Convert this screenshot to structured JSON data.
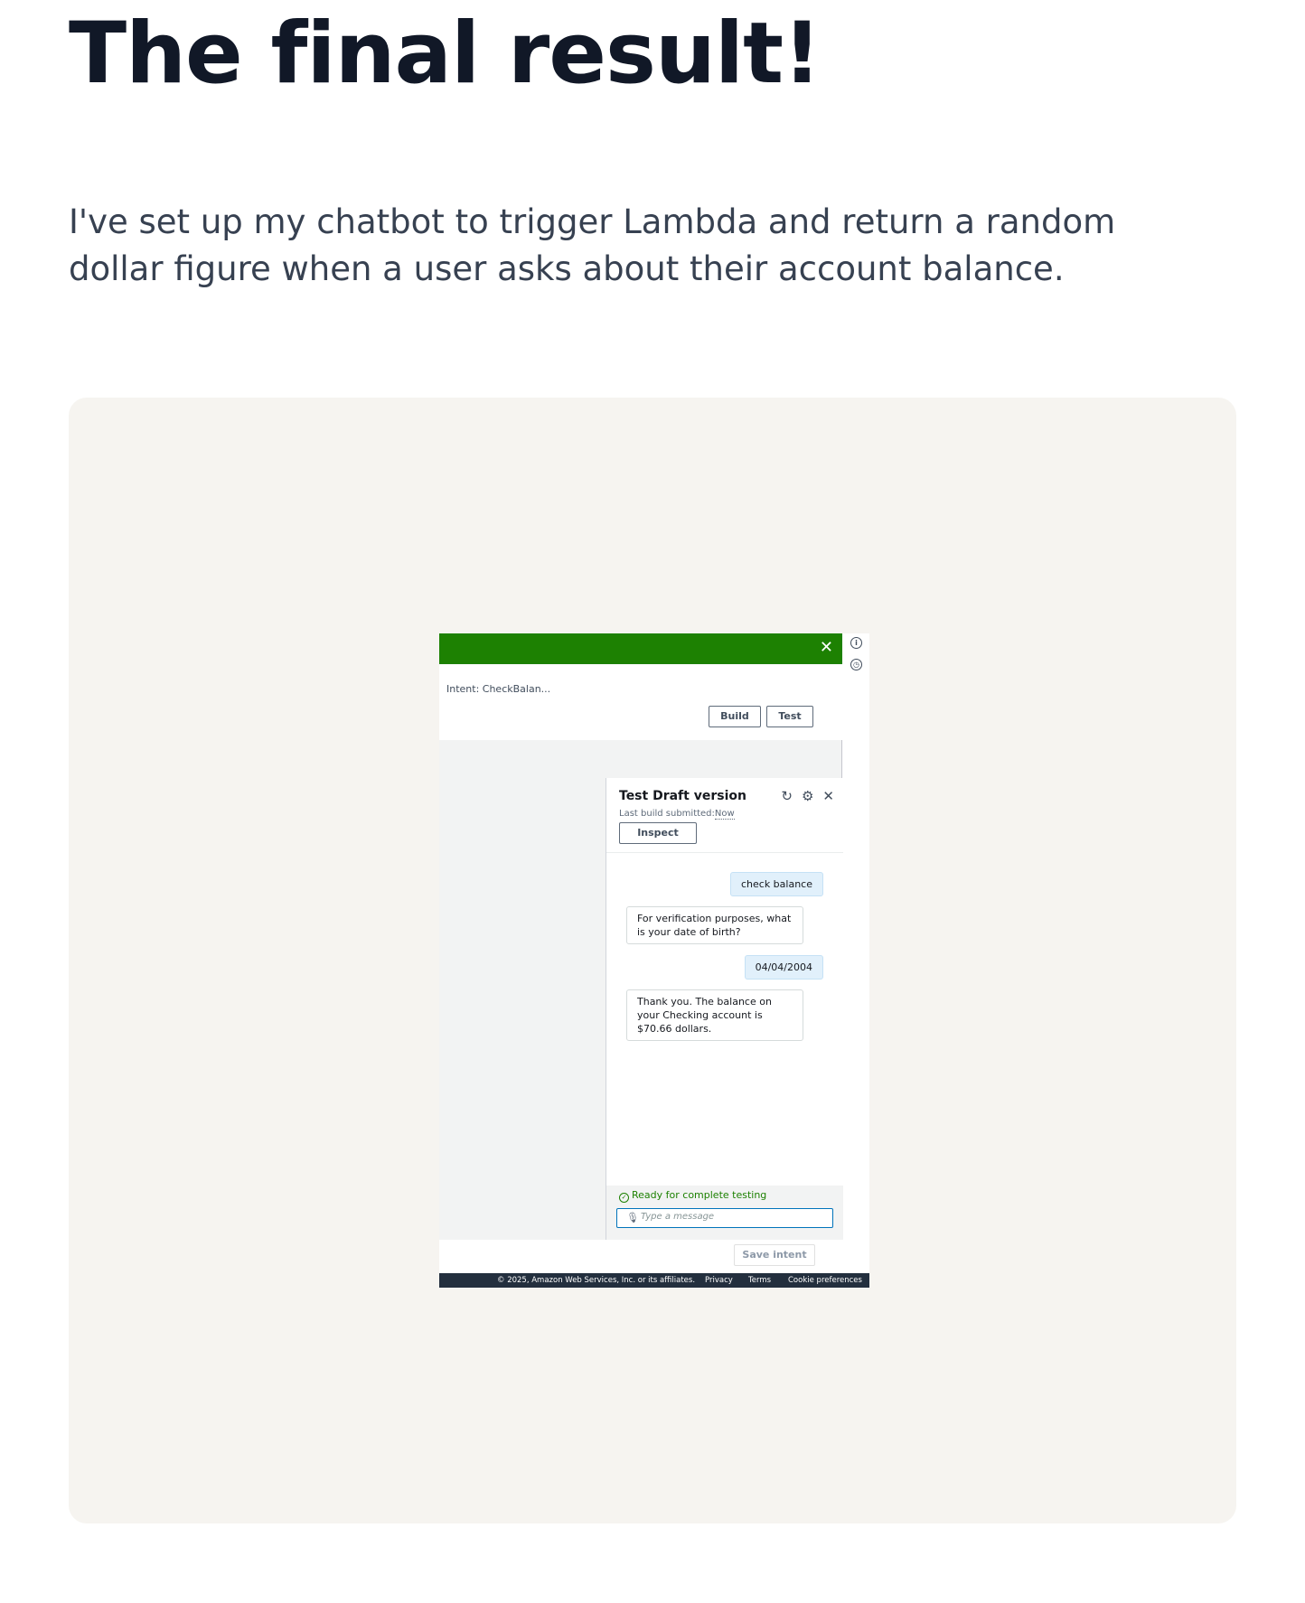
{
  "page": {
    "title": "The final result!",
    "intro": "I've set up my chatbot to trigger Lambda and return a random dollar figure when a user asks about their account balance."
  },
  "screenshot": {
    "banner_close_icon": "close-icon",
    "intent_label": "Intent: CheckBalan...",
    "build_button": "Build",
    "test_button": "Test",
    "test_panel": {
      "title": "Test Draft version",
      "last_build_label": "Last build submitted:",
      "last_build_value": "Now",
      "inspect_button": "Inspect",
      "messages": [
        {
          "role": "user",
          "text": "check balance"
        },
        {
          "role": "bot",
          "text": "For verification purposes, what is your date of birth?"
        },
        {
          "role": "user",
          "text": "04/04/2004"
        },
        {
          "role": "bot",
          "text": "Thank you. The balance on your Checking account is $70.66 dollars."
        }
      ],
      "status": "Ready for complete testing",
      "input_placeholder": "Type a message"
    },
    "save_button": "Save intent",
    "footer": {
      "copyright": "© 2025, Amazon Web Services, Inc. or its affiliates.",
      "privacy": "Privacy",
      "terms": "Terms",
      "cookies": "Cookie preferences"
    }
  },
  "colors": {
    "banner_green": "#1d8102",
    "card_background": "#f6f4f0",
    "title_text": "#111827",
    "footer_bg": "#232f3e"
  }
}
